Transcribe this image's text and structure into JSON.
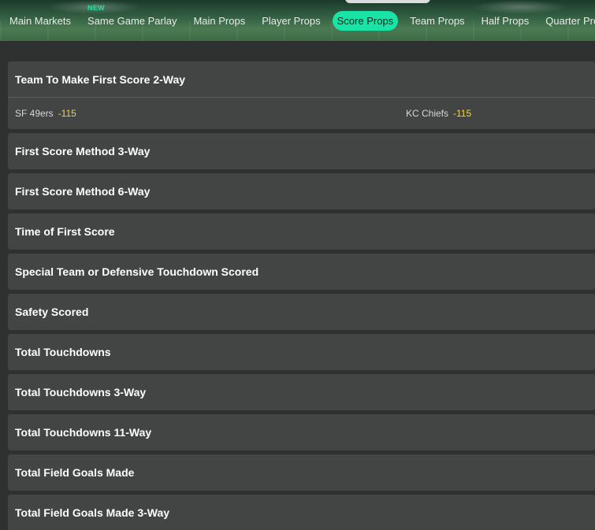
{
  "tabs": [
    {
      "label": "Main Markets",
      "badge": ""
    },
    {
      "label": "Same Game Parlay",
      "badge": "NEW"
    },
    {
      "label": "Main Props",
      "badge": ""
    },
    {
      "label": "Player Props",
      "badge": ""
    },
    {
      "label": "Score Props",
      "badge": "",
      "active": true
    },
    {
      "label": "Team Props",
      "badge": ""
    },
    {
      "label": "Half Props",
      "badge": ""
    },
    {
      "label": "Quarter Props",
      "badge": ""
    }
  ],
  "markets": [
    {
      "title": "Team To Make First Score 2-Way",
      "expanded": true,
      "selections": [
        {
          "team": "SF 49ers",
          "price": "-115"
        },
        {
          "team": "KC Chiefs",
          "price": "-115"
        }
      ]
    },
    {
      "title": "First Score Method 3-Way"
    },
    {
      "title": "First Score Method 6-Way"
    },
    {
      "title": "Time of First Score"
    },
    {
      "title": "Special Team or Defensive Touchdown Scored"
    },
    {
      "title": "Safety Scored"
    },
    {
      "title": "Total Touchdowns"
    },
    {
      "title": "Total Touchdowns 3-Way"
    },
    {
      "title": "Total Touchdowns 11-Way"
    },
    {
      "title": "Total Field Goals Made"
    },
    {
      "title": "Total Field Goals Made 3-Way"
    }
  ],
  "colors": {
    "accent": "#19e3a6",
    "price": "#f5d43a",
    "card": "#424543",
    "background": "#2f3130"
  }
}
